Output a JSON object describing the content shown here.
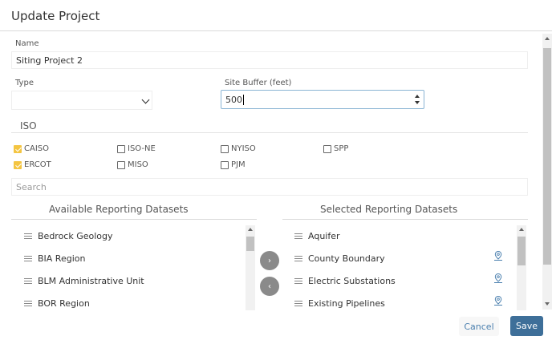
{
  "dialog": {
    "title": "Update Project"
  },
  "name_field": {
    "label": "Name",
    "value": "Siting Project 2"
  },
  "type_field": {
    "label": "Type",
    "value": ""
  },
  "buffer_field": {
    "label": "Site Buffer (feet)",
    "value": "500"
  },
  "iso": {
    "heading": "ISO",
    "options": [
      {
        "label": "CAISO",
        "checked": true
      },
      {
        "label": "ISO-NE",
        "checked": false
      },
      {
        "label": "NYISO",
        "checked": false
      },
      {
        "label": "SPP",
        "checked": false
      },
      {
        "label": "ERCOT",
        "checked": true
      },
      {
        "label": "MISO",
        "checked": false
      },
      {
        "label": "PJM",
        "checked": false
      }
    ]
  },
  "search": {
    "placeholder": "Search"
  },
  "available": {
    "heading": "Available Reporting Datasets",
    "items": [
      "Bedrock Geology",
      "BIA Region",
      "BLM Administrative Unit",
      "BOR Region"
    ]
  },
  "selected": {
    "heading": "Selected Reporting Datasets",
    "items": [
      "Aquifer",
      "County Boundary",
      "Electric Substations",
      "Existing Pipelines"
    ]
  },
  "transfer": {
    "add_glyph": "›",
    "remove_glyph": "‹"
  },
  "footer": {
    "cancel_label": "Cancel",
    "save_label": "Save"
  },
  "colors": {
    "checked": "#f4c542",
    "primary": "#3e6f99",
    "link": "#4a7fae"
  },
  "icons": {
    "drag": "drag-handle-icon",
    "map_pin": "map-pin-icon"
  }
}
